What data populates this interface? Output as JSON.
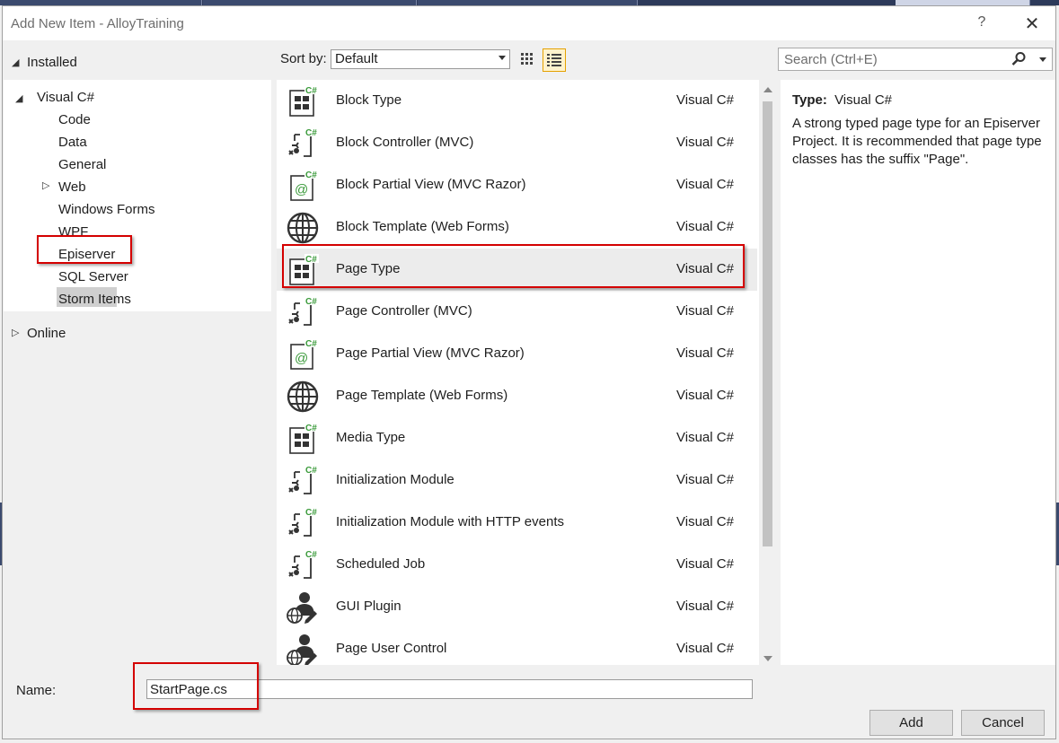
{
  "window": {
    "title": "Add New Item - AlloyTraining",
    "help_label": "?",
    "close_label": "✕"
  },
  "tree": {
    "installed": "Installed",
    "visual_csharp": "Visual C#",
    "children": [
      "Code",
      "Data",
      "General",
      "Web",
      "Windows Forms",
      "WPF",
      "Episerver",
      "SQL Server",
      "Storm Items"
    ],
    "selected": "Episerver",
    "online": "Online"
  },
  "toolbar": {
    "sort_label": "Sort by:",
    "sort_value": "Default",
    "search_placeholder": "Search (Ctrl+E)"
  },
  "items": [
    {
      "name": "Block Type",
      "lang": "Visual C#",
      "icon": "type-class-icon"
    },
    {
      "name": "Block Controller (MVC)",
      "lang": "Visual C#",
      "icon": "controller-icon"
    },
    {
      "name": "Block Partial View (MVC Razor)",
      "lang": "Visual C#",
      "icon": "razor-view-icon"
    },
    {
      "name": "Block Template (Web Forms)",
      "lang": "Visual C#",
      "icon": "globe-icon"
    },
    {
      "name": "Page Type",
      "lang": "Visual C#",
      "icon": "type-class-icon"
    },
    {
      "name": "Page Controller (MVC)",
      "lang": "Visual C#",
      "icon": "controller-icon"
    },
    {
      "name": "Page Partial View (MVC Razor)",
      "lang": "Visual C#",
      "icon": "razor-view-icon"
    },
    {
      "name": "Page Template (Web Forms)",
      "lang": "Visual C#",
      "icon": "globe-icon"
    },
    {
      "name": "Media Type",
      "lang": "Visual C#",
      "icon": "type-class-icon"
    },
    {
      "name": "Initialization Module",
      "lang": "Visual C#",
      "icon": "controller-icon"
    },
    {
      "name": "Initialization Module with HTTP events",
      "lang": "Visual C#",
      "icon": "controller-icon"
    },
    {
      "name": "Scheduled Job",
      "lang": "Visual C#",
      "icon": "controller-icon"
    },
    {
      "name": "GUI Plugin",
      "lang": "Visual C#",
      "icon": "user-control-icon"
    },
    {
      "name": "Page User Control",
      "lang": "Visual C#",
      "icon": "user-control-icon"
    }
  ],
  "selected_item": "Page Type",
  "details": {
    "type_label": "Type:",
    "type_value": "Visual C#",
    "description": "A strong typed page type for an Episerver Project. It is recommended that page type classes has the suffix \"Page\"."
  },
  "footer": {
    "name_label": "Name:",
    "name_value": "StartPage.cs",
    "add_label": "Add",
    "cancel_label": "Cancel"
  },
  "colors": {
    "highlight_box": "#d40000",
    "csharp_badge": "#3a9a3a",
    "selected_row": "#ececec"
  }
}
